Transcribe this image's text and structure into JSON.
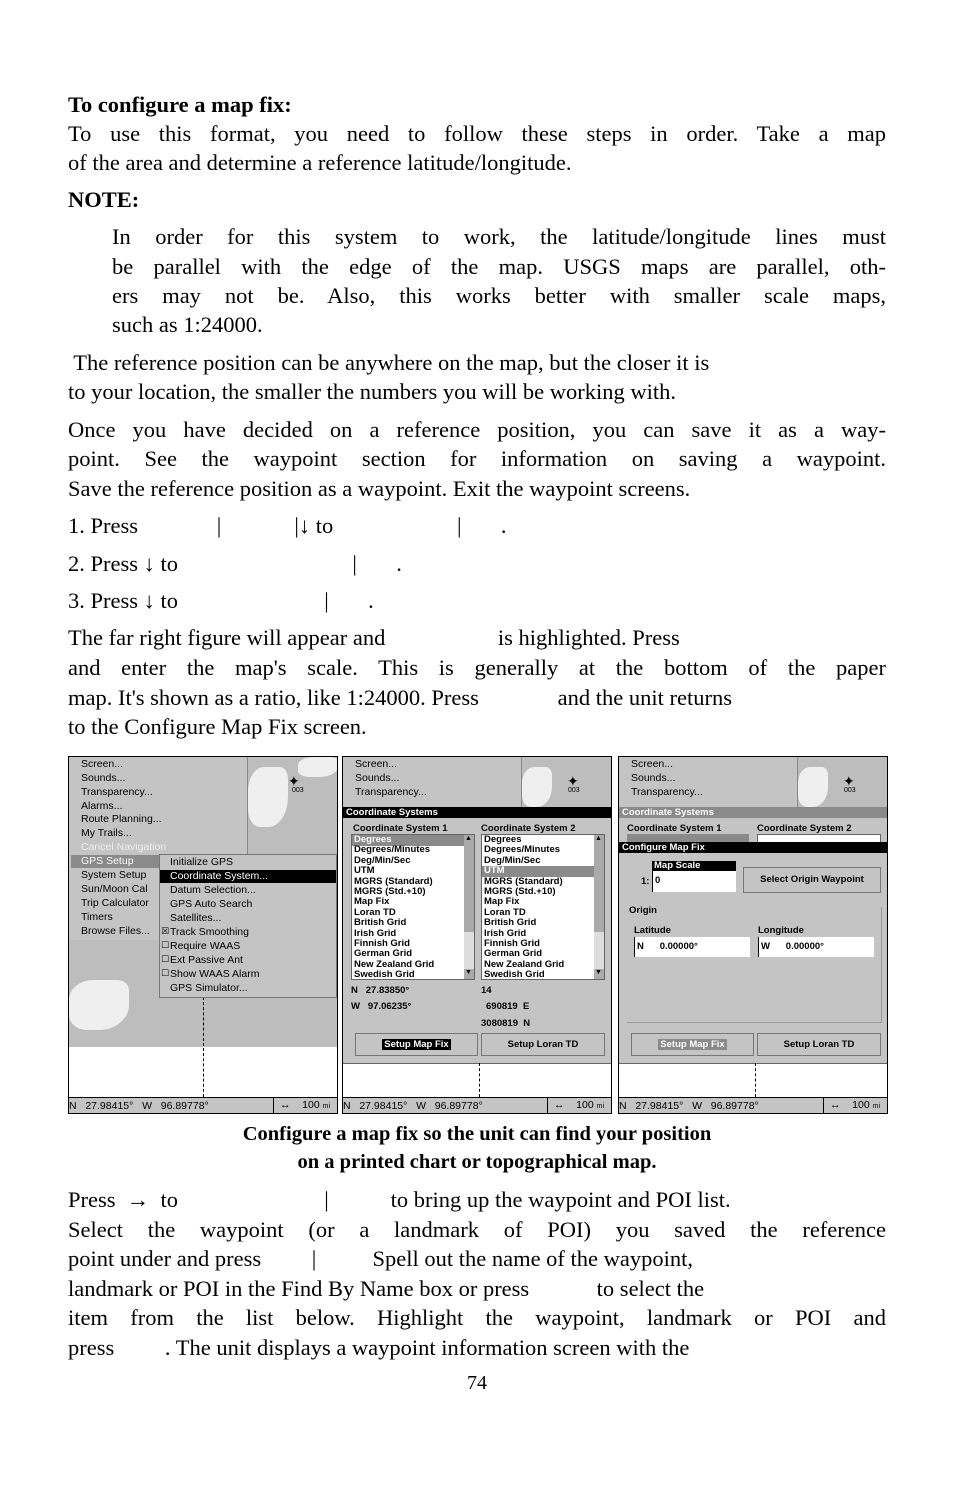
{
  "heading": "To configure a map fix:",
  "para1": [
    "To use this format, you need to follow these steps in order. Take a map",
    "of the area and determine a reference latitude/longitude."
  ],
  "note_label": "NOTE:",
  "note": [
    "In order for this system to work, the latitude/longitude lines must",
    "be parallel with the edge of the map. USGS maps are parallel, oth-",
    "ers may not be. Also, this works better with smaller scale maps,",
    "such as 1:24000."
  ],
  "para2": [
    " The reference position can be anywhere on the map, but the closer it is",
    "to your location, the smaller the numbers you will be working with."
  ],
  "para3": [
    "Once you have decided on a reference position, you can save it as a way-",
    "point. See the waypoint section for information on saving a waypoint.",
    "Save the reference position as a waypoint. Exit the waypoint screens."
  ],
  "steps": [
    "1. Press              |             |↓ to                      |       .",
    "2. Press ↓ to                               |       .",
    "3. Press ↓ to                          |       ."
  ],
  "para4": [
    "The far right figure will appear and                    is highlighted. Press",
    "and enter the map's scale. This is generally at the bottom of the paper",
    "map. It's shown as a ratio, like 1:24000. Press              and the unit returns",
    "to the Configure Map Fix screen."
  ],
  "caption": [
    "Configure a map fix so the unit can find your position",
    "on a printed chart or topographical map."
  ],
  "para5": [
    "Press  →  to                          |           to bring up the waypoint and POI list.",
    "Select the waypoint (or a landmark of POI) you saved the reference",
    "point under and press         |          Spell out the name of the waypoint,",
    "landmark or POI in the Find By Name box or press            to select the",
    "item from the list below. Highlight the waypoint, landmark or POI and",
    "press         . The unit displays a waypoint information screen with the"
  ],
  "page_number": "74",
  "screens": {
    "main_menu": [
      "Screen...",
      "Sounds...",
      "Transparency...",
      "Alarms...",
      "Route Planning...",
      "My Trails...",
      "Cancel Navigation",
      "GPS Setup",
      "System Setup",
      "Sun/Moon Cal",
      "Trip Calculator",
      "Timers",
      "Browse Files..."
    ],
    "gps_submenu": [
      "Initialize GPS",
      "Coordinate System...",
      "Datum Selection...",
      "GPS Auto Search",
      "Satellites...",
      "Track Smoothing",
      "Require WAAS",
      "Ext Passive Ant",
      "Show WAAS Alarm",
      "GPS Simulator..."
    ],
    "checkboxes": {
      "Track Smoothing": true,
      "Require WAAS": false,
      "Ext Passive Ant": false,
      "Show WAAS Alarm": false
    },
    "waypoint_label": "003",
    "status": {
      "lat": "N   27.98415°   W   96.89778°",
      "scale": "↔    100",
      "unit": "mi"
    },
    "coord_title": "Coordinate Systems",
    "cs1_label": "Coordinate System 1",
    "cs2_label": "Coordinate System 2",
    "coord_options": [
      "Degrees",
      "Degrees/Minutes",
      "Deg/Min/Sec",
      "UTM",
      "MGRS (Standard)",
      "MGRS (Std.+10)",
      "Map Fix",
      "Loran TD",
      "British Grid",
      "Irish Grid",
      "Finnish Grid",
      "German Grid",
      "New Zealand Grid",
      "Swedish Grid"
    ],
    "cs1_selected": "Degrees",
    "cs2_selected": "UTM",
    "readout1": [
      "N   27.83850°",
      "W   97.06235°"
    ],
    "readout2": [
      "14",
      "690819  E",
      "3080819  N"
    ],
    "setup_map_fix": "Setup Map Fix",
    "setup_loran": "Setup Loran TD",
    "config_title": "Configure Map Fix",
    "map_scale_label": "Map Scale",
    "scale_prefix": "1:",
    "scale_value": "0",
    "select_origin": "Select Origin Waypoint",
    "origin_label": "Origin",
    "latitude_label": "Latitude",
    "longitude_label": "Longitude",
    "latitude_value": "N      0.00000°",
    "longitude_value": "W      0.00000°",
    "partial_alarms": "Alarms..."
  }
}
